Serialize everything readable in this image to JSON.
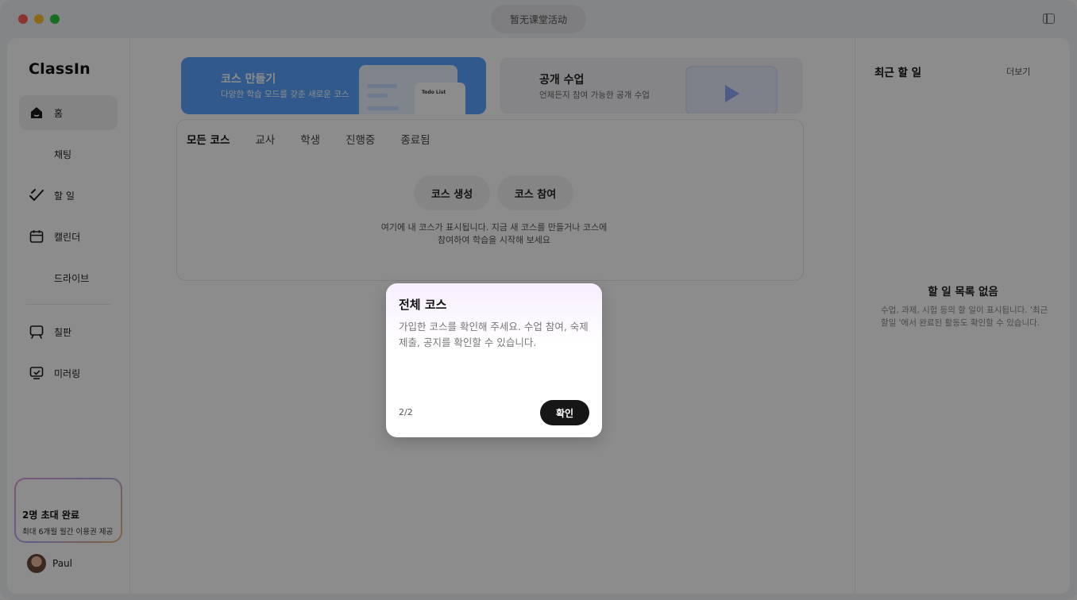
{
  "window": {
    "status_pill": "暂无课堂活动"
  },
  "sidebar": {
    "logo": "ClassIn",
    "items": [
      {
        "label": "홈",
        "icon": "home-icon",
        "active": true
      },
      {
        "label": "채팅",
        "icon": "",
        "active": false
      },
      {
        "label": "할 일",
        "icon": "checkmark-icon",
        "active": false
      },
      {
        "label": "캘린더",
        "icon": "calendar-icon",
        "active": false
      },
      {
        "label": "드라이브",
        "icon": "",
        "active": false
      },
      {
        "label": "칠판",
        "icon": "blackboard-icon",
        "active": false
      },
      {
        "label": "미러링",
        "icon": "mirroring-icon",
        "active": false
      }
    ],
    "invite": {
      "title": "2명 초대 완료",
      "subtitle": "최대 6개월 월간 이용권 제공"
    },
    "user": {
      "name": "Paul"
    }
  },
  "main": {
    "banner_create": {
      "title": "코스 만들기",
      "subtitle": "다양한 학습 모드를 갖춘 새로운 코스",
      "card_label": "Todo List"
    },
    "banner_open": {
      "title": "공개 수업",
      "subtitle": "언제든지 참여 가능한 공개 수업"
    },
    "tabs": [
      "모든 코스",
      "교사",
      "학생",
      "진행중",
      "종료됨"
    ],
    "buttons": {
      "create": "코스 생성",
      "join": "코스 참여"
    },
    "empty_text_line1": "여기에 내 코스가 표시됩니다. 지금 새 코스를 만들거나 코스에",
    "empty_text_line2": "참여하여 학습을 시작해 보세요"
  },
  "right_panel": {
    "title": "최근 할 일",
    "more": "더보기",
    "empty_title": "할 일 목록 없음",
    "empty_desc": "수업, 과제, 시험 등의 할 일이 표시됩니다. '최근 할일 '에서 완료된 활동도 확인할 수 있습니다."
  },
  "modal": {
    "title": "전체 코스",
    "body": "가입한 코스를 확인해 주세요. 수업 참여, 숙제 제출, 공지를 확인할 수 있습니다.",
    "step": "2/2",
    "confirm": "확인"
  },
  "colors": {
    "accent_blue": "#5aa2ff",
    "button_dark": "#161616"
  }
}
